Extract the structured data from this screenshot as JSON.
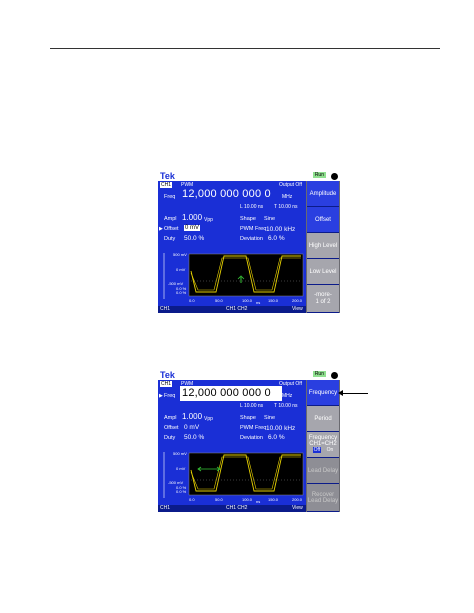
{
  "screens": [
    {
      "brand": "Tek",
      "run_mode": "Run",
      "channel": "CH1",
      "mode": "PWM",
      "output": "Output Off",
      "freq_label": "Freq",
      "freq_value": "12,000 000 000 0",
      "freq_unit": "MHz",
      "l_time": "L 10.00 ns",
      "t_time": "T 10.00 ns",
      "ampl_label": "Ampl",
      "ampl_value": "1.000",
      "ampl_unit": "Vpp",
      "shape_label": "Shape",
      "shape_value": "Sine",
      "offset_label": "Offset",
      "offset_value": "0 mV",
      "pwm_freq_label": "PWM Freq",
      "pwm_freq_value": "10.00 kHz",
      "duty_label": "Duty",
      "duty_value": "50.0 %",
      "deviation_label": "Deviation",
      "deviation_value": "6.0 %",
      "y_top": "500 mV",
      "y_mid": "0 mV",
      "y_bot": "-500 mV",
      "y_small1": "0.0 %",
      "y_small2": "0.0 %",
      "x_ticks": [
        "0.0",
        "50.0",
        "100.0",
        "150.0",
        "200.0"
      ],
      "x_unit": "ns",
      "bottom_left": "CH1",
      "bottom_tabs": "CH1  CH2",
      "bottom_right": "View",
      "softkeys": [
        "Amplitude",
        "Offset",
        "High Level",
        "Low Level",
        "-more-",
        "1 of 2"
      ]
    },
    {
      "brand": "Tek",
      "run_mode": "Run",
      "channel": "CH1",
      "mode": "PWM",
      "output": "Output Off",
      "freq_label": "Freq",
      "freq_value": "12,000 000 000 0",
      "freq_unit": "MHz",
      "l_time": "L 10.00 ns",
      "t_time": "T 10.00 ns",
      "ampl_label": "Ampl",
      "ampl_value": "1.000",
      "ampl_unit": "Vpp",
      "shape_label": "Shape",
      "shape_value": "Sine",
      "offset_label": "Offset",
      "offset_value": "0 mV",
      "pwm_freq_label": "PWM Freq",
      "pwm_freq_value": "10.00 kHz",
      "duty_label": "Duty",
      "duty_value": "50.0 %",
      "deviation_label": "Deviation",
      "deviation_value": "6.0 %",
      "y_top": "500 mV",
      "y_mid": "0 mV",
      "y_bot": "-500 mV",
      "y_small1": "0.0 %",
      "y_small2": "0.0 %",
      "x_ticks": [
        "0.0",
        "50.0",
        "100.0",
        "150.0",
        "200.0"
      ],
      "x_unit": "ns",
      "bottom_left": "CH1",
      "bottom_tabs": "CH1  CH2",
      "bottom_right": "View",
      "softkeys": [
        "Frequency",
        "Period",
        "Frequency CH1=CH2",
        "Off",
        "On",
        "Lead Delay",
        "Recover Lead Delay"
      ]
    }
  ],
  "colors": {
    "screen_bg": "#1a2fd6",
    "softkey_active": "#2a3fe0",
    "softkey_inactive": "#8e8e95",
    "trace_yellow": "#e8d200",
    "trace_green": "#37c837"
  }
}
